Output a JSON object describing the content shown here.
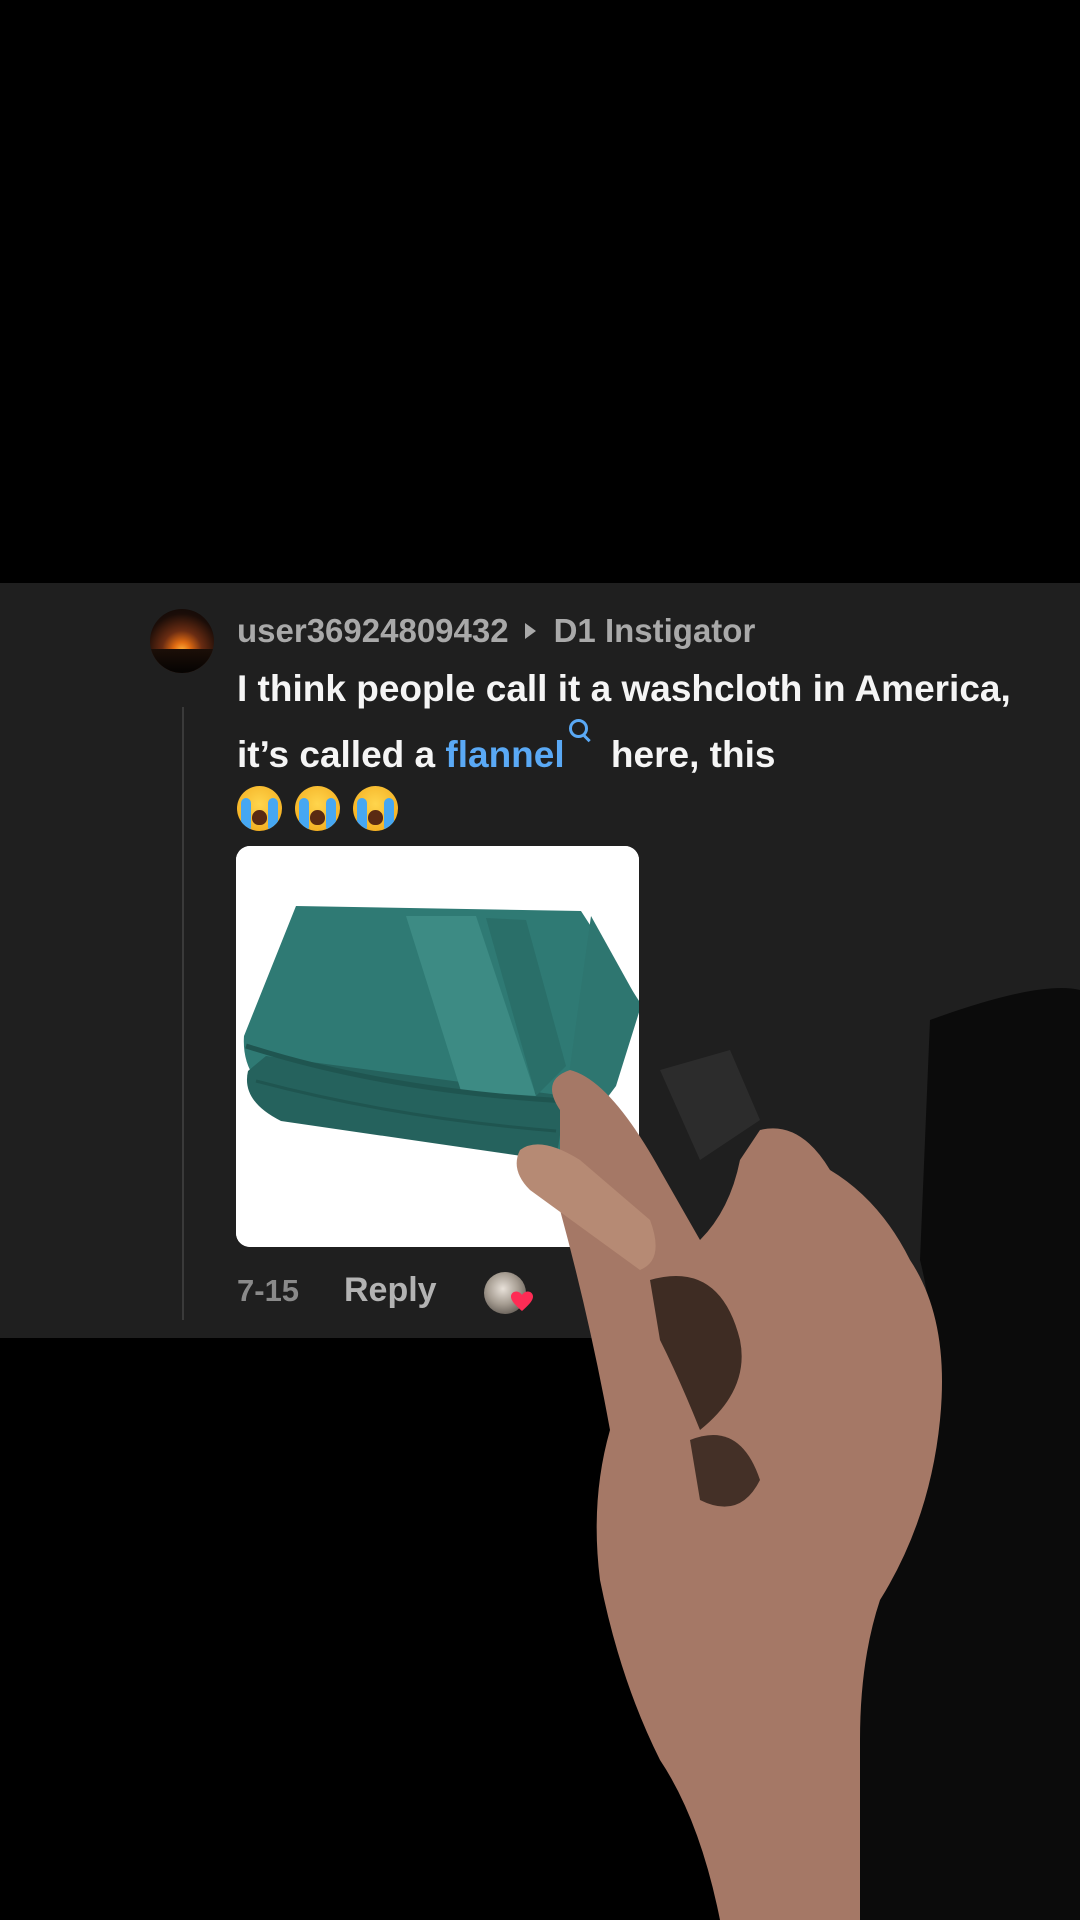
{
  "comment": {
    "username": "user36924809432",
    "reply_to": "D1 Instigator",
    "text_part1": "I think people call it a washcloth in America, it’s called a ",
    "link_text": "flannel",
    "text_part2": " here, this",
    "emojis": [
      "loudly-crying-face",
      "loudly-crying-face",
      "loudly-crying-face"
    ],
    "date": "7-15",
    "reply_label": "Reply",
    "liked_by_creator": true
  },
  "colors": {
    "card_bg": "#1f1f1f",
    "username": "#a9a9a9",
    "link": "#5aa9f5",
    "heart": "#fe2c55"
  }
}
